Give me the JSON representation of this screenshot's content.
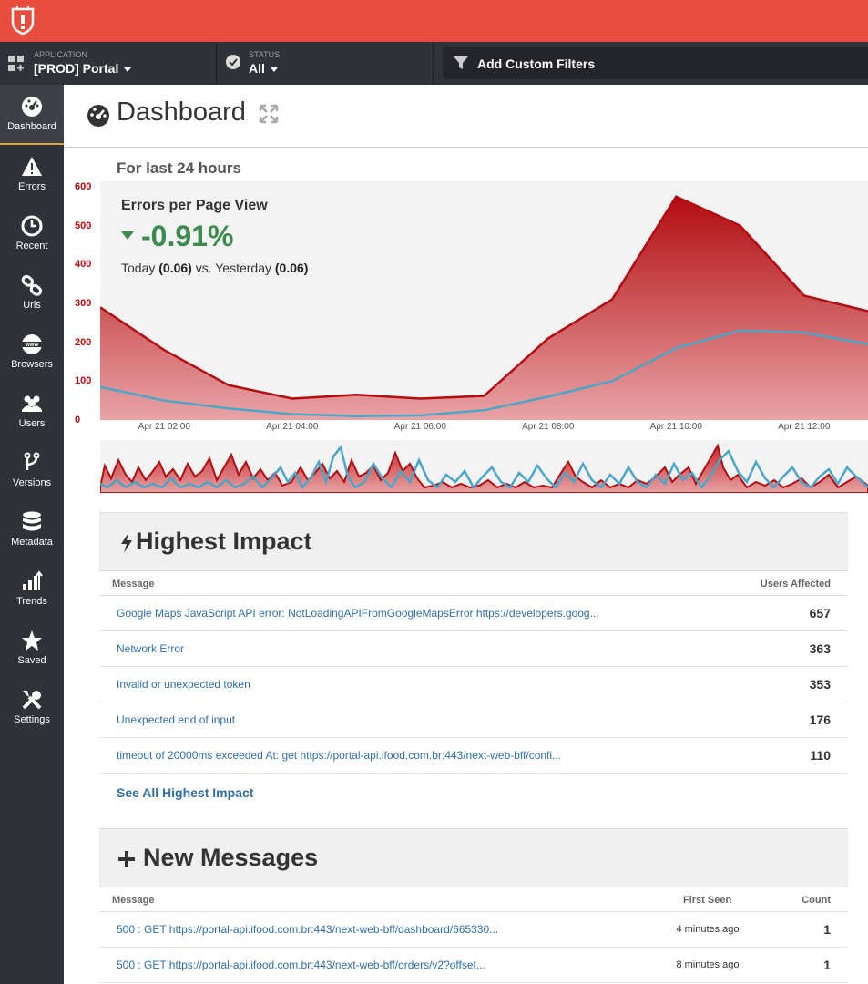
{
  "brand": {
    "accent": "#e84c3d",
    "dark": "#2f3238",
    "logo_icon": "bug-shield-icon"
  },
  "filters": {
    "application_label": "APPLICATION",
    "application_value": "[PROD] Portal",
    "status_label": "STATUS",
    "status_value": "All",
    "custom_placeholder": "Add Custom Filters"
  },
  "sidebar": {
    "items": [
      {
        "label": "Dashboard",
        "icon": "gauge-icon",
        "active": true
      },
      {
        "label": "Errors",
        "icon": "warning-icon"
      },
      {
        "label": "Recent",
        "icon": "clock-icon"
      },
      {
        "label": "Urls",
        "icon": "link-icon"
      },
      {
        "label": "Browsers",
        "icon": "globe-icon"
      },
      {
        "label": "Users",
        "icon": "users-icon"
      },
      {
        "label": "Versions",
        "icon": "branch-icon"
      },
      {
        "label": "Metadata",
        "icon": "database-icon"
      },
      {
        "label": "Trends",
        "icon": "bar-trend-icon"
      },
      {
        "label": "Saved",
        "icon": "star-icon"
      },
      {
        "label": "Settings",
        "icon": "tools-icon"
      }
    ]
  },
  "page": {
    "title": "Dashboard",
    "range": "For last 24 hours"
  },
  "kpi": {
    "title": "Errors per Page View",
    "change": "-0.91%",
    "today_prefix": "Today",
    "today_value": "(0.06)",
    "mid": "vs. Yesterday",
    "yesterday_value": "(0.06)"
  },
  "chart_data": {
    "type": "area",
    "x": [
      "Apr 21 01:00",
      "Apr 21 02:00",
      "Apr 21 03:00",
      "Apr 21 04:00",
      "Apr 21 05:00",
      "Apr 21 06:00",
      "Apr 21 07:00",
      "Apr 21 08:00",
      "Apr 21 09:00",
      "Apr 21 10:00",
      "Apr 21 11:00",
      "Apr 21 12:00",
      "Apr 21 13:00"
    ],
    "x_tick_labels": [
      "Apr 21 02:00",
      "Apr 21 04:00",
      "Apr 21 06:00",
      "Apr 21 08:00",
      "Apr 21 10:00",
      "Apr 21 12:00"
    ],
    "series": [
      {
        "values": [
          290,
          180,
          90,
          55,
          65,
          55,
          62,
          210,
          310,
          575,
          500,
          320,
          280
        ],
        "color": "#b20d11"
      },
      {
        "values": [
          85,
          50,
          30,
          15,
          10,
          12,
          25,
          60,
          100,
          185,
          230,
          225,
          195
        ],
        "color": "#4aa6c8"
      }
    ],
    "ylim": [
      0,
      600
    ],
    "y_ticks": [
      0,
      100,
      200,
      300,
      400,
      500,
      600
    ],
    "grid": false
  },
  "highest_impact": {
    "title": "Highest Impact",
    "col_message": "Message",
    "col_users": "Users Affected",
    "rows": [
      {
        "message": "Google Maps JavaScript API error: NotLoadingAPIFromGoogleMapsError https://developers.goog...",
        "count": "657"
      },
      {
        "message": "Network Error",
        "count": "363"
      },
      {
        "message": "Invalid or unexpected token",
        "count": "353"
      },
      {
        "message": "Unexpected end of input",
        "count": "176"
      },
      {
        "message": "timeout of 20000ms exceeded At: get https://portal-api.ifood.com.br:443/next-web-bff/confi...",
        "count": "110"
      }
    ],
    "see_all": "See All Highest Impact"
  },
  "new_messages": {
    "title": "New Messages",
    "col_message": "Message",
    "col_first_seen": "First Seen",
    "col_count": "Count",
    "rows": [
      {
        "message": "500 : GET https://portal-api.ifood.com.br:443/next-web-bff/dashboard/665330...",
        "first_seen": "4 minutes ago",
        "count": "1"
      },
      {
        "message": "500 : GET https://portal-api.ifood.com.br:443/next-web-bff/orders/v2?offset...",
        "first_seen": "8 minutes ago",
        "count": "1"
      }
    ]
  }
}
